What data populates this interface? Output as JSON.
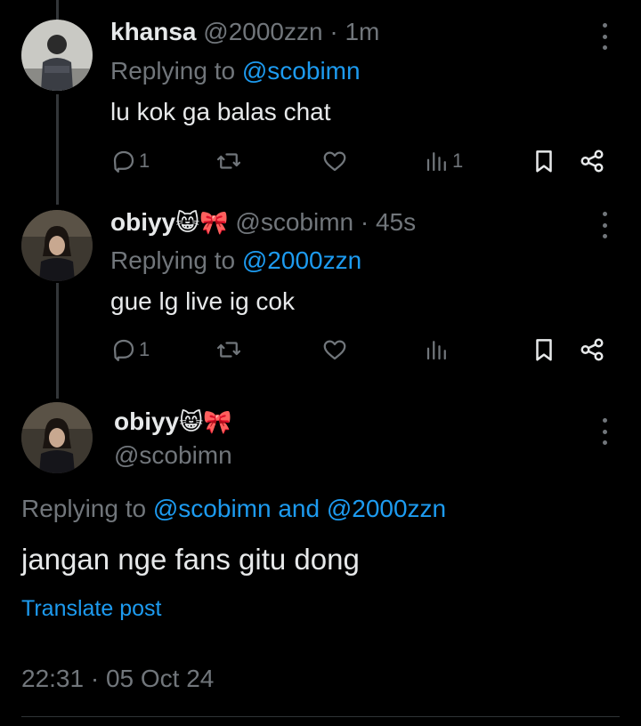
{
  "tweets": [
    {
      "name": "khansa",
      "handle": "@2000zzn",
      "time": "· 1m",
      "replying_prefix": "Replying to",
      "replying_to": "@scobimn",
      "text": "lu kok ga balas chat",
      "reply_count": "1",
      "retweet_count": "",
      "like_count": "",
      "view_count": "1"
    },
    {
      "name": "obiyy",
      "name_emoji": "😸🎀",
      "handle": "@scobimn",
      "time": "· 45s",
      "replying_prefix": "Replying to",
      "replying_to": "@2000zzn",
      "text": "gue lg live ig cok",
      "reply_count": "1",
      "retweet_count": "",
      "like_count": "",
      "view_count": ""
    }
  ],
  "main": {
    "name": "obiyy",
    "name_emoji": "😸🎀",
    "handle": "@scobimn",
    "replying_prefix": "Replying to",
    "replying_to_1": "@scobimn",
    "replying_and": "and",
    "replying_to_2": "@2000zzn",
    "text": "jangan nge fans gitu dong",
    "translate": "Translate post",
    "timestamp": "22:31 · 05 Oct 24"
  },
  "colors": {
    "background": "#000000",
    "text": "#e7e9ea",
    "secondary": "#71767b",
    "accent": "#1d9bf0"
  }
}
